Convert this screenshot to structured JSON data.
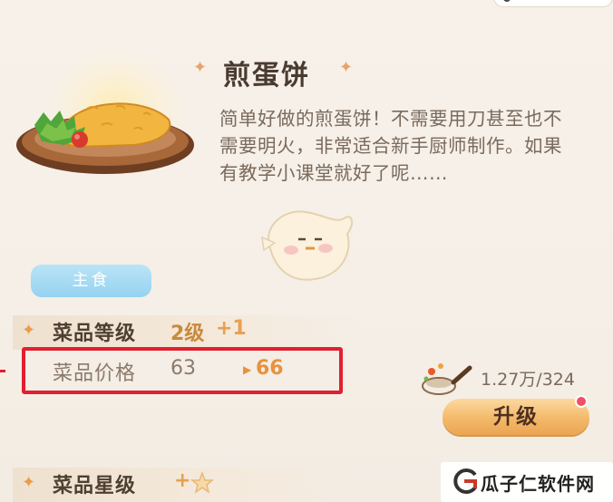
{
  "dish": {
    "name": "煎蛋饼",
    "description": "简单好做的煎蛋饼！不需要用刀甚至也不需要明火，非常适合新手厨师制作。如果有教学小课堂就好了呢……",
    "category": "主食"
  },
  "stats": {
    "level_label": "菜品等级",
    "level_value": "2级",
    "level_increase": "+1",
    "price_label": "菜品价格",
    "price_current": "63",
    "price_next": "66",
    "stars_label": "菜品星级",
    "stars_increase": "+"
  },
  "upgrade": {
    "cost": "1.27万/324",
    "button_label": "升级"
  },
  "watermark": {
    "text": "瓜子仁软件网"
  },
  "colors": {
    "accent_orange": "#e8923e",
    "highlight_red": "#e02030",
    "tag_blue": "#96d2f0"
  },
  "icons": {
    "title_ornament": "sparkle-icon",
    "dish_image": "omelette-plate-icon",
    "mascot": "chick-mascot-icon",
    "upgrade_cost": "frying-pan-icon",
    "star_rating": "star-icon"
  }
}
